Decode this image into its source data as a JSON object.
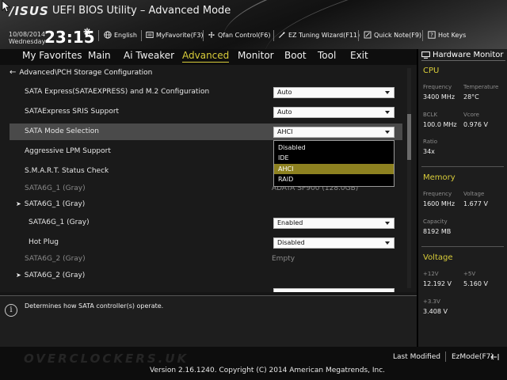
{
  "header": {
    "logo": "/ISUS",
    "title": "UEFI BIOS Utility – Advanced Mode",
    "date": "10/08/2014",
    "weekday": "Wednesday",
    "time": "23:15",
    "language": "English",
    "my_favorite": "MyFavorite(F3)",
    "qfan": "Qfan Control(F6)",
    "ez_tuning": "EZ Tuning Wizard(F11)",
    "quick_note": "Quick Note(F9)",
    "hot_keys": "Hot Keys"
  },
  "nav": {
    "tabs": [
      "My Favorites",
      "Main",
      "Ai Tweaker",
      "Advanced",
      "Monitor",
      "Boot",
      "Tool",
      "Exit"
    ],
    "active": "Advanced"
  },
  "main": {
    "breadcrumb": "Advanced\\PCH Storage Configuration",
    "rows": {
      "sata_express": {
        "label": "SATA Express(SATAEXPRESS) and M.2 Configuration",
        "value": "Auto"
      },
      "sris": {
        "label": "SATAExpress SRIS Support",
        "value": "Auto"
      },
      "sata_mode": {
        "label": "SATA Mode Selection",
        "value": "AHCI"
      },
      "lpm": {
        "label": "Aggressive LPM Support"
      },
      "smart": {
        "label": "S.M.A.R.T. Status Check"
      },
      "sata6g1_info": {
        "label": "SATA6G_1 (Gray)",
        "value": "ADATA SP900 (128.0GB)"
      },
      "sata6g1_sub": {
        "label": "SATA6G_1 (Gray)"
      },
      "sata6g1_enable": {
        "label": "SATA6G_1 (Gray)",
        "value": "Enabled"
      },
      "hot_plug": {
        "label": "Hot Plug",
        "value": "Disabled"
      },
      "sata6g2_info": {
        "label": "SATA6G_2 (Gray)",
        "value": "Empty"
      },
      "sata6g2_sub": {
        "label": "SATA6G_2 (Gray)"
      }
    },
    "dropdown": {
      "options": [
        "Disabled",
        "IDE",
        "AHCI",
        "RAID"
      ],
      "selected": "AHCI"
    }
  },
  "info": {
    "text": "Determines how SATA controller(s) operate."
  },
  "hwmon": {
    "title": "Hardware Monitor",
    "cpu": {
      "label": "CPU",
      "frequency_key": "Frequency",
      "frequency": "3400 MHz",
      "temperature_key": "Temperature",
      "temperature": "28°C",
      "bclk_key": "BCLK",
      "bclk": "100.0 MHz",
      "vcore_key": "Vcore",
      "vcore": "0.976 V",
      "ratio_key": "Ratio",
      "ratio": "34x"
    },
    "memory": {
      "label": "Memory",
      "frequency_key": "Frequency",
      "frequency": "1600 MHz",
      "voltage_key": "Voltage",
      "voltage": "1.677 V",
      "capacity_key": "Capacity",
      "capacity": "8192 MB"
    },
    "voltage": {
      "label": "Voltage",
      "v12_key": "+12V",
      "v12": "12.192 V",
      "v5_key": "+5V",
      "v5": "5.160 V",
      "v33_key": "+3.3V",
      "v33": "3.408 V"
    }
  },
  "footer": {
    "watermark": "OVERCLOCKERS.UK",
    "last_modified": "Last Modified",
    "ez_mode": "EzMode(F7)",
    "version": "Version 2.16.1240. Copyright (C) 2014 American Megatrends, Inc."
  }
}
